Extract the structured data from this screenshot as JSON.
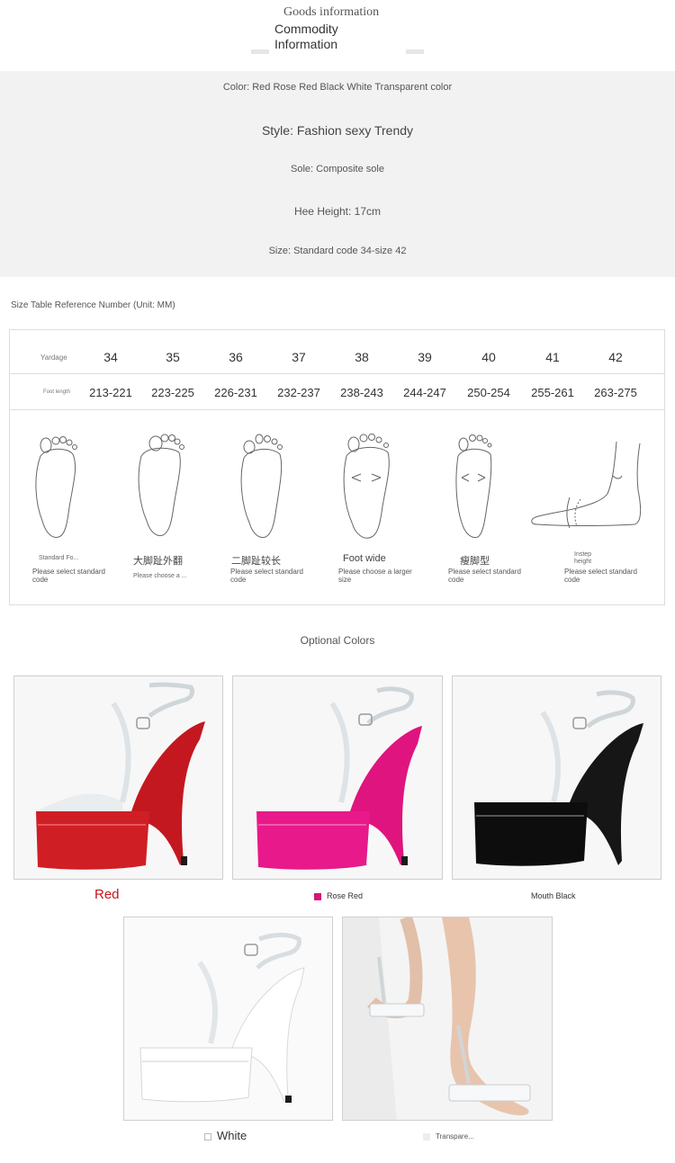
{
  "header": {
    "title_en": "Goods information",
    "subtitle": "Commodity Information"
  },
  "info": {
    "color": "Color: Red Rose Red Black White Transparent color",
    "style": "Style: Fashion sexy Trendy",
    "sole": "Sole: Composite sole",
    "heel": "Hee Height: 17cm",
    "size": "Size: Standard code 34-size 42"
  },
  "size_table": {
    "title": "Size Table Reference Number (Unit: MM)",
    "yardage_label": "Yardage",
    "foot_length_label": "Foot length",
    "yardage": [
      "34",
      "35",
      "36",
      "37",
      "38",
      "39",
      "40",
      "41",
      "42"
    ],
    "foot_length": [
      "213-221",
      "223-225",
      "226-231",
      "232-237",
      "238-243",
      "244-247",
      "250-254",
      "255-261",
      "263-275"
    ],
    "foot_types": [
      {
        "name": "Standard Fo...",
        "note": "Please select standard code"
      },
      {
        "name": "大脚趾外翻",
        "note": "Please choose a ..."
      },
      {
        "name": "二脚趾较长",
        "note": "Please select standard code"
      },
      {
        "name": "Foot wide",
        "note": "Please choose a larger size"
      },
      {
        "name": "瘦脚型",
        "note": "Please select standard code"
      },
      {
        "name": "Instep height",
        "note": "Please select standard code"
      }
    ]
  },
  "colors": {
    "title": "Optional Colors",
    "items": [
      {
        "label": "Red",
        "color": "#c8141c"
      },
      {
        "label": "Rose Red",
        "color": "#d8137a"
      },
      {
        "label": "Mouth Black",
        "color": "#111111"
      },
      {
        "label": "White",
        "color": "#ffffff"
      },
      {
        "label": "Transpare...",
        "color": "#eeeeee"
      }
    ]
  }
}
